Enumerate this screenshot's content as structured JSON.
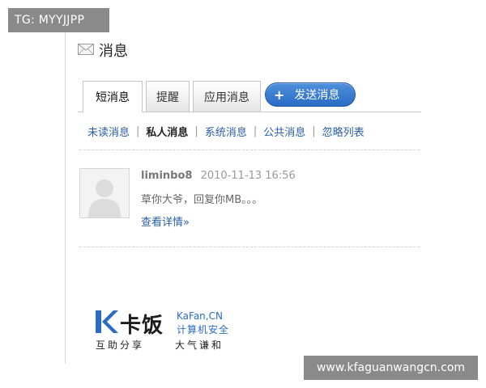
{
  "watermark_tl": "TG: MYYJJPP",
  "page_title": "消息",
  "tabs": [
    {
      "label": "短消息"
    },
    {
      "label": "提醒"
    },
    {
      "label": "应用消息"
    }
  ],
  "send_button": {
    "label": "发送消息",
    "icon": "+"
  },
  "subnav": [
    {
      "label": "未读消息"
    },
    {
      "label": "私人消息"
    },
    {
      "label": "系统消息"
    },
    {
      "label": "公共消息"
    },
    {
      "label": "忽略列表"
    }
  ],
  "message": {
    "username": "liminbo8",
    "datetime": "2010-11-13 16:56",
    "text": "草你大爷，回复你MB。。。",
    "detail_link": "查看详情»"
  },
  "logo": {
    "brand": "卡饭",
    "brand_en": "KaFan,CN",
    "brand_cn": "计算机安全",
    "slogan_left": "互助分享",
    "slogan_right": "大气谦和"
  },
  "watermark_br": "www.kfaguanwangcn.com",
  "colors": {
    "link": "#2a5ea8",
    "button": "#2a6cc5",
    "watermark_bg": "#8a8a8a"
  }
}
